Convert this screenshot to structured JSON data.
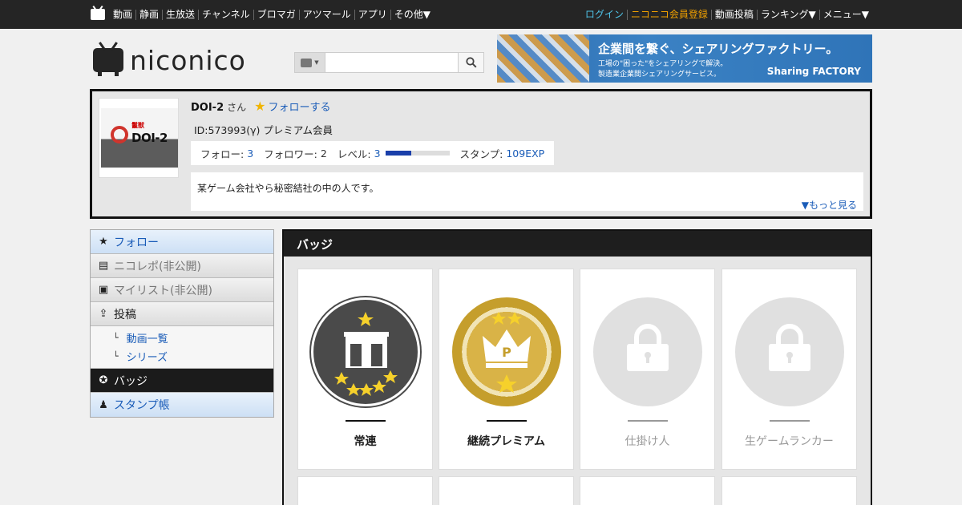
{
  "topbar": {
    "left_links": [
      "動画",
      "静画",
      "生放送",
      "チャンネル",
      "ブロマガ",
      "アツマール",
      "アプリ",
      "その他▼"
    ],
    "login": "ログイン",
    "register": "ニコニコ会員登録",
    "right_links": [
      "動画投稿",
      "ランキング▼",
      "メニュー▼"
    ]
  },
  "header": {
    "logo_text": "niconico",
    "search_placeholder": ""
  },
  "banner": {
    "title": "企業間を繋ぐ、シェアリングファクトリー。",
    "subtitle": "工場の\"困った\"をシェアリングで解決。\n製造業企業間シェアリングサービス。",
    "brand": "Sharing FACTORY"
  },
  "profile": {
    "avatar_tag": "鬣獣",
    "avatar_text": "DOI-2",
    "name": "DOI-2",
    "honorific": "さん",
    "follow_label": "フォローする",
    "id_line": "ID:573993(γ) プレミアム会員",
    "stats": {
      "follow_label": "フォロー:",
      "follow_value": "3",
      "follower_label": "フォロワー:",
      "follower_value": "2",
      "level_label": "レベル:",
      "level_value": "3",
      "level_progress": 0.4,
      "stamp_label": "スタンプ:",
      "stamp_value": "109EXP"
    },
    "description": "某ゲーム会社やら秘密結社の中の人です。",
    "more_label": "▼もっと見る"
  },
  "sidemenu": {
    "items": [
      {
        "label": "フォロー",
        "icon": "star-icon"
      },
      {
        "label": "ニコレポ(非公開)",
        "icon": "report-icon"
      },
      {
        "label": "マイリスト(非公開)",
        "icon": "mylist-icon"
      },
      {
        "label": "投稿",
        "icon": "upload-icon"
      }
    ],
    "sub_items": [
      {
        "prefix": "└",
        "label": "動画一覧"
      },
      {
        "prefix": "└",
        "label": "シリーズ"
      }
    ],
    "badge_item": {
      "label": "バッジ",
      "icon": "badge-icon"
    },
    "stamp_item": {
      "label": "スタンプ帳",
      "icon": "stamp-icon"
    }
  },
  "badges": {
    "heading": "バッジ",
    "cards": [
      {
        "label": "常連",
        "state": "earned",
        "icon": "regular-badge-icon"
      },
      {
        "label": "継続プレミアム",
        "state": "earned",
        "icon": "premium-crown-badge-icon"
      },
      {
        "label": "仕掛け人",
        "state": "locked",
        "icon": "lock-icon"
      },
      {
        "label": "生ゲームランカー",
        "state": "locked",
        "icon": "lock-icon"
      }
    ]
  },
  "colors": {
    "topbar_bg": "#252525",
    "link_blue": "#1a5cb8",
    "login_cyan": "#4fc3e8",
    "register_orange": "#f0a000",
    "gold": "#d9b347"
  }
}
